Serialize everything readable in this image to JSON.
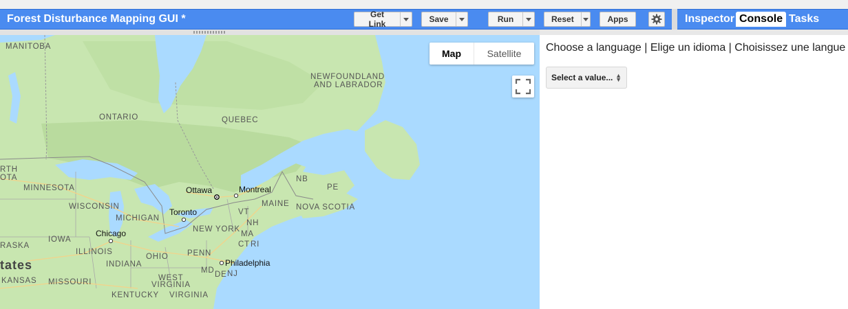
{
  "app": {
    "title": "Forest Disturbance Mapping GUI *"
  },
  "toolbar": {
    "get_link": "Get Link",
    "save": "Save",
    "run": "Run",
    "reset": "Reset",
    "apps": "Apps",
    "settings_icon": "gear-icon"
  },
  "right_tabs": [
    "Inspector",
    "Console",
    "Tasks"
  ],
  "active_tab": "Console",
  "map": {
    "type_buttons": [
      "Map",
      "Satellite"
    ],
    "selected_type": "Map",
    "fullscreen_icon": "fullscreen-icon",
    "colors": {
      "water": "#aadaff",
      "land": "#c8e6b0",
      "forest": "#b5d89a",
      "park": "#a9d18e"
    },
    "labels": [
      "MANITOBA",
      "ONTARIO",
      "QUEBEC",
      "NEWFOUNDLAND",
      "AND LABRADOR",
      "MINNESOTA",
      "WISCONSIN",
      "MICHIGAN",
      "IOWA",
      "ILLINOIS",
      "INDIANA",
      "OHIO",
      "PENN",
      "NEW YORK",
      "MAINE",
      "NOVA SCOTIA",
      "NB",
      "PE",
      "VT",
      "NH",
      "MA",
      "CT",
      "RI",
      "NJ",
      "DE",
      "MD",
      "WEST",
      "VIRGINIA",
      "KENTUCKY",
      "MISSOURI",
      "KANSAS",
      "RASKA",
      "tates",
      "RTH",
      "OTA",
      "Ottawa",
      "Montreal",
      "Toronto",
      "Chicago",
      "Philadelphia"
    ]
  },
  "console": {
    "prompt": "Choose a language | Elige un idioma | Choisissez une langue",
    "select_placeholder": "Select a value..."
  }
}
